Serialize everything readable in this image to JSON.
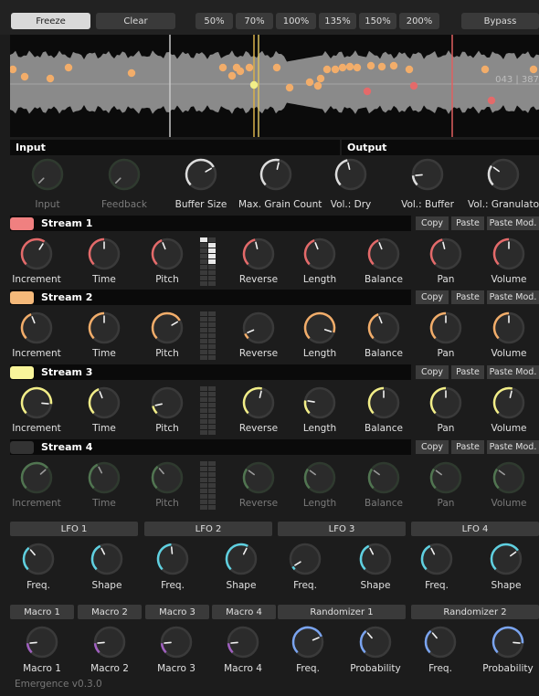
{
  "toolbar": {
    "freeze": "Freeze",
    "clear": "Clear",
    "zoom": [
      "50%",
      "70%",
      "100%",
      "135%",
      "150%",
      "200%"
    ],
    "bypass": "Bypass"
  },
  "waveform": {
    "counter": "043 | 387"
  },
  "sections": {
    "input": "Input",
    "output": "Output"
  },
  "io_knobs": [
    {
      "label": "Input",
      "dim": true,
      "value": 0
    },
    {
      "label": "Feedback",
      "dim": true,
      "value": 0
    },
    {
      "label": "Buffer Size",
      "dim": false,
      "value": 0.72
    },
    {
      "label": "Max. Grain Count",
      "dim": false,
      "value": 0.55
    },
    {
      "label": "Vol.: Dry",
      "dim": false,
      "value": 0.45
    },
    {
      "label": "Vol.: Buffer",
      "dim": false,
      "value": 0.15
    },
    {
      "label": "Vol.: Granulato",
      "dim": false,
      "value": 0.3
    }
  ],
  "stream_buttons": {
    "copy": "Copy",
    "paste": "Paste",
    "paste_mod": "Paste Mod."
  },
  "streams": [
    {
      "name": "Stream 1",
      "color": "#f08080",
      "knob_color": "#e46a6a",
      "dim": false,
      "knobs": [
        {
          "label": "Increment",
          "value": 0.62
        },
        {
          "label": "Time",
          "value": 0.5
        },
        {
          "label": "Pitch",
          "value": 0.42
        },
        {
          "label": "Reverse",
          "value": 0.45
        },
        {
          "label": "Length",
          "value": 0.42
        },
        {
          "label": "Balance",
          "value": 0.42
        },
        {
          "label": "Pan",
          "value": 0.45
        },
        {
          "label": "Volume",
          "value": 0.5
        }
      ]
    },
    {
      "name": "Stream 2",
      "color": "#f5b97a",
      "knob_color": "#f2ad6a",
      "dim": false,
      "knobs": [
        {
          "label": "Increment",
          "value": 0.42
        },
        {
          "label": "Time",
          "value": 0.5
        },
        {
          "label": "Pitch",
          "value": 0.72
        },
        {
          "label": "Reverse",
          "value": 0.08
        },
        {
          "label": "Length",
          "value": 0.9
        },
        {
          "label": "Balance",
          "value": 0.42
        },
        {
          "label": "Pan",
          "value": 0.5
        },
        {
          "label": "Volume",
          "value": 0.5
        }
      ]
    },
    {
      "name": "Stream 3",
      "color": "#f9f59a",
      "knob_color": "#f2ee88",
      "dim": false,
      "knobs": [
        {
          "label": "Increment",
          "value": 0.85
        },
        {
          "label": "Time",
          "value": 0.42
        },
        {
          "label": "Pitch",
          "value": 0.12
        },
        {
          "label": "Reverse",
          "value": 0.55
        },
        {
          "label": "Length",
          "value": 0.2
        },
        {
          "label": "Balance",
          "value": 0.5
        },
        {
          "label": "Pan",
          "value": 0.5
        },
        {
          "label": "Volume",
          "value": 0.55
        }
      ]
    },
    {
      "name": "Stream 4",
      "color": "#333333",
      "knob_color": "#5e8a5e",
      "dim": true,
      "knobs": [
        {
          "label": "Increment",
          "value": 0.68
        },
        {
          "label": "Time",
          "value": 0.4
        },
        {
          "label": "Pitch",
          "value": 0.35
        },
        {
          "label": "Reverse",
          "value": 0.3
        },
        {
          "label": "Length",
          "value": 0.3
        },
        {
          "label": "Balance",
          "value": 0.3
        },
        {
          "label": "Pan",
          "value": 0.3
        },
        {
          "label": "Volume",
          "value": 0.3
        }
      ]
    }
  ],
  "lfos": [
    {
      "name": "LFO 1",
      "knobs": [
        {
          "label": "Freq.",
          "value": 0.35
        },
        {
          "label": "Shape",
          "value": 0.4
        }
      ]
    },
    {
      "name": "LFO 2",
      "knobs": [
        {
          "label": "Freq.",
          "value": 0.48
        },
        {
          "label": "Shape",
          "value": 0.6
        }
      ]
    },
    {
      "name": "LFO 3",
      "knobs": [
        {
          "label": "Freq.",
          "value": 0.05
        },
        {
          "label": "Shape",
          "value": 0.4
        }
      ]
    },
    {
      "name": "LFO 4",
      "knobs": [
        {
          "label": "Freq.",
          "value": 0.4
        },
        {
          "label": "Shape",
          "value": 0.7
        }
      ]
    }
  ],
  "macros": [
    {
      "name": "Macro 1",
      "label": "Macro 1",
      "value": 0.15
    },
    {
      "name": "Macro 2",
      "label": "Macro 2",
      "value": 0.15
    },
    {
      "name": "Macro 3",
      "label": "Macro 3",
      "value": 0.15
    },
    {
      "name": "Macro 4",
      "label": "Macro 4",
      "value": 0.15
    }
  ],
  "randomizers": [
    {
      "name": "Randomizer 1",
      "knobs": [
        {
          "label": "Freq.",
          "value": 0.75
        },
        {
          "label": "Probability",
          "value": 0.35
        }
      ]
    },
    {
      "name": "Randomizer 2",
      "knobs": [
        {
          "label": "Freq.",
          "value": 0.35
        },
        {
          "label": "Probability",
          "value": 0.85
        }
      ]
    }
  ],
  "footer": "Emergence v0.3.0"
}
